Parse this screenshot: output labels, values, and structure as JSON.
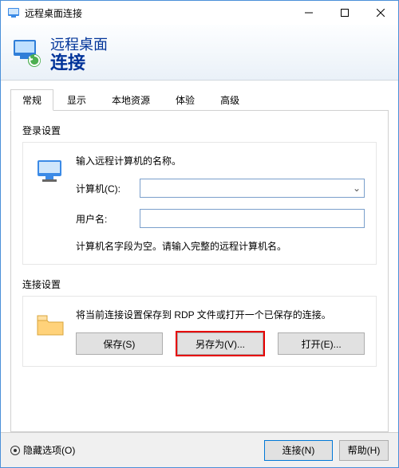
{
  "window": {
    "title": "远程桌面连接"
  },
  "banner": {
    "line1": "远程桌面",
    "line2": "连接"
  },
  "tabs": {
    "general": "常规",
    "display": "显示",
    "local": "本地资源",
    "experience": "体验",
    "advanced": "高级"
  },
  "login_group": {
    "label": "登录设置",
    "prompt": "输入远程计算机的名称。",
    "computer_label": "计算机(C):",
    "computer_value": "",
    "username_label": "用户名:",
    "username_value": "",
    "hint": "计算机名字段为空。请输入完整的远程计算机名。"
  },
  "conn_group": {
    "label": "连接设置",
    "prompt": "将当前连接设置保存到 RDP 文件或打开一个已保存的连接。",
    "save": "保存(S)",
    "save_as": "另存为(V)...",
    "open": "打开(E)..."
  },
  "footer": {
    "hide_options": "隐藏选项(O)",
    "connect": "连接(N)",
    "help": "帮助(H)"
  }
}
